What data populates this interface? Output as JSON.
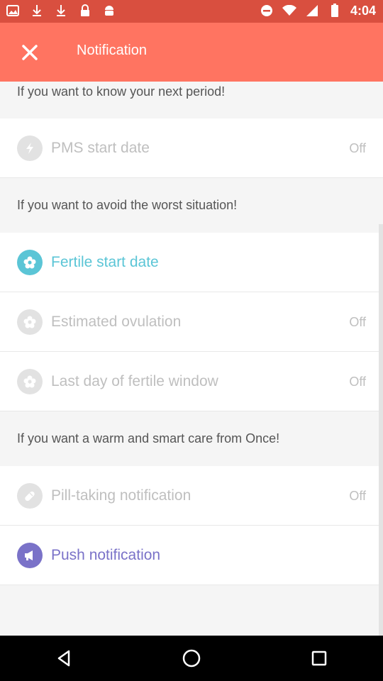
{
  "status_bar": {
    "time": "4:04",
    "left_icons": [
      "photo-icon",
      "download-icon",
      "download-icon",
      "lock-icon",
      "android-icon"
    ],
    "right_icons": [
      "do-not-disturb-icon",
      "wifi-icon",
      "signal-icon",
      "battery-icon"
    ]
  },
  "header": {
    "title": "Notification",
    "close_icon": "close-icon",
    "color": "#ff7461"
  },
  "sections": [
    {
      "header": "If you want to know your next period!"
    },
    {
      "header": "If you want to avoid the worst situation!"
    },
    {
      "header": "If you want a warm and smart care from Once!"
    }
  ],
  "rows": [
    {
      "label": "PMS start date",
      "state": "Off",
      "icon": "bolt-icon"
    },
    {
      "label": "Fertile start date",
      "state": "",
      "icon": "flower-icon",
      "color": "#5bc5d6"
    },
    {
      "label": "Estimated ovulation",
      "state": "Off",
      "icon": "flower-icon"
    },
    {
      "label": "Last day of fertile window",
      "state": "Off",
      "icon": "flower-icon"
    },
    {
      "label": "Pill-taking notification",
      "state": "Off",
      "icon": "pill-icon"
    },
    {
      "label": "Push notification",
      "state": "",
      "icon": "megaphone-icon",
      "color": "#7a72c8"
    }
  ],
  "nav": [
    "back-icon",
    "home-icon",
    "recents-icon"
  ]
}
